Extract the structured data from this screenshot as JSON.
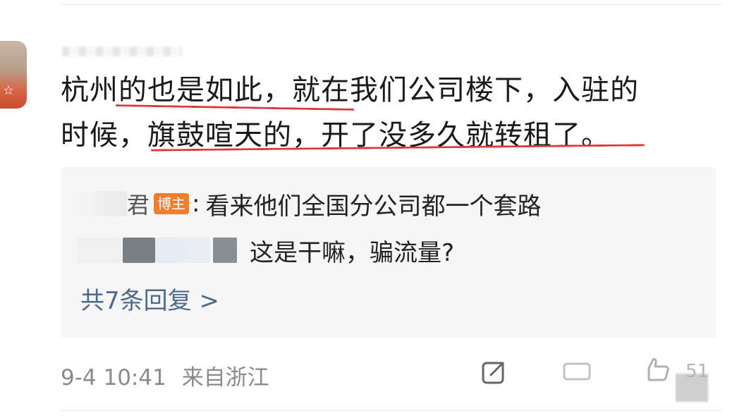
{
  "comment": {
    "line1": "杭州的也是如此，就在我们公司楼下，入驻的",
    "line2": "时候，旗鼓喧天的，开了没多久就转租了。"
  },
  "replies": [
    {
      "author_visible_fragment": "君",
      "badge": "博主",
      "separator": ":",
      "text": "看来他们全国分公司都一个套路"
    },
    {
      "text": "这是干嘛，骗流量?"
    }
  ],
  "more_replies": "共7条回复 >",
  "meta": {
    "timestamp": "9-4 10:41",
    "location": "来自浙江"
  },
  "actions": {
    "like_count": "51"
  },
  "colors": {
    "underline": "#e0353a",
    "badge": "#f27c2f",
    "link": "#4e6a8a",
    "reply_bg": "#f6f6f6"
  },
  "icons": [
    "share-icon",
    "comment-icon",
    "like-icon"
  ]
}
